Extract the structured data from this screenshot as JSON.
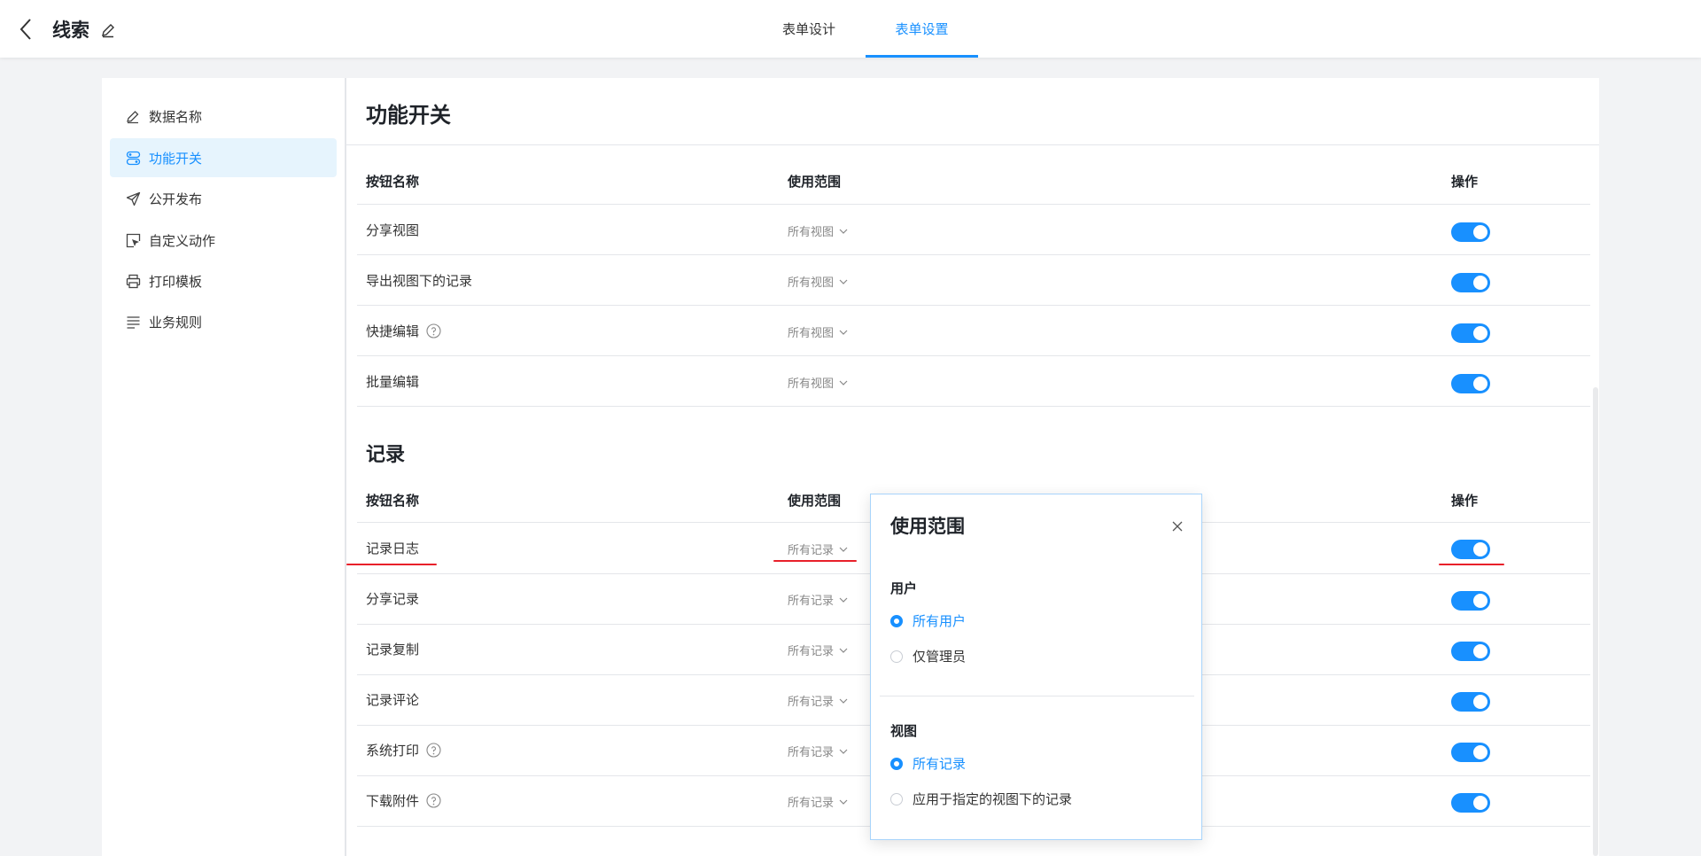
{
  "header": {
    "app_title": "线索",
    "tabs": [
      {
        "label": "表单设计",
        "active": false
      },
      {
        "label": "表单设置",
        "active": true
      }
    ]
  },
  "colors": {
    "accent": "#1890ff",
    "annotation": "#e8202a"
  },
  "sidebar": {
    "items": [
      {
        "label": "数据名称",
        "icon": "pencil-icon",
        "active": false
      },
      {
        "label": "功能开关",
        "icon": "toggle-switch-icon",
        "active": true
      },
      {
        "label": "公开发布",
        "icon": "paper-plane-icon",
        "active": false
      },
      {
        "label": "自定义动作",
        "icon": "cursor-box-icon",
        "active": false
      },
      {
        "label": "打印模板",
        "icon": "printer-icon",
        "active": false
      },
      {
        "label": "业务规则",
        "icon": "list-lines-icon",
        "active": false
      }
    ]
  },
  "main": {
    "title": "功能开关",
    "columns": {
      "name": "按钮名称",
      "scope": "使用范围",
      "action": "操作"
    },
    "view_section": {
      "rows": [
        {
          "name": "分享视图",
          "scope": "所有视图",
          "help": false,
          "enabled": true
        },
        {
          "name": "导出视图下的记录",
          "scope": "所有视图",
          "help": false,
          "enabled": true
        },
        {
          "name": "快捷编辑",
          "scope": "所有视图",
          "help": true,
          "enabled": true
        },
        {
          "name": "批量编辑",
          "scope": "所有视图",
          "help": false,
          "enabled": true
        }
      ]
    },
    "record_section": {
      "title": "记录",
      "rows": [
        {
          "name": "记录日志",
          "scope": "所有记录",
          "help": false,
          "enabled": true
        },
        {
          "name": "分享记录",
          "scope": "所有记录",
          "help": false,
          "enabled": true
        },
        {
          "name": "记录复制",
          "scope": "所有记录",
          "help": false,
          "enabled": true
        },
        {
          "name": "记录评论",
          "scope": "所有记录",
          "help": false,
          "enabled": true
        },
        {
          "name": "系统打印",
          "scope": "所有记录",
          "help": true,
          "enabled": true
        },
        {
          "name": "下载附件",
          "scope": "所有记录",
          "help": true,
          "enabled": true
        }
      ]
    }
  },
  "popover": {
    "title": "使用范围",
    "user_group": {
      "label": "用户",
      "options": [
        {
          "label": "所有用户",
          "selected": true
        },
        {
          "label": "仅管理员",
          "selected": false
        }
      ]
    },
    "view_group": {
      "label": "视图",
      "options": [
        {
          "label": "所有记录",
          "selected": true
        },
        {
          "label": "应用于指定的视图下的记录",
          "selected": false
        }
      ]
    }
  }
}
